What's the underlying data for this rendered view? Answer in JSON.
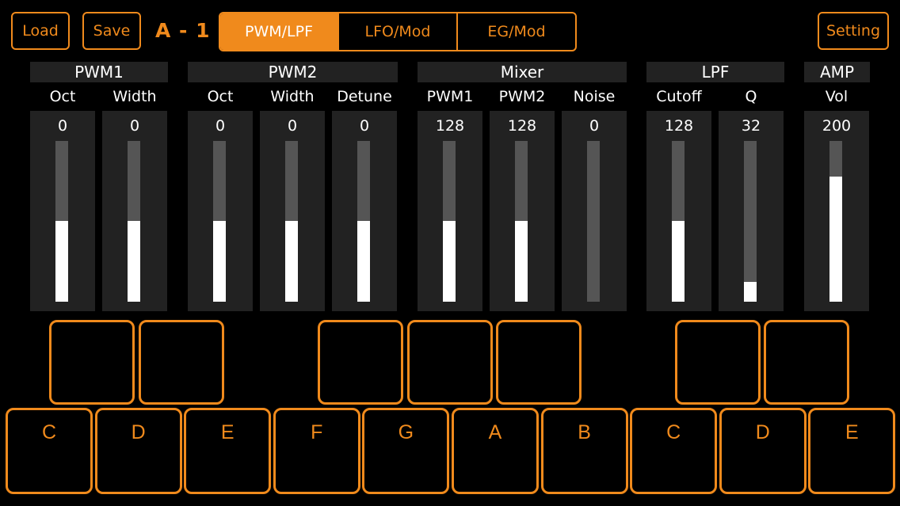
{
  "header": {
    "load_label": "Load",
    "save_label": "Save",
    "preset_name": "A - 1",
    "setting_label": "Setting",
    "accent_color": "#f08a1c",
    "tabs": [
      {
        "label": "PWM/LPF",
        "active": true
      },
      {
        "label": "LFO/Mod",
        "active": false
      },
      {
        "label": "EG/Mod",
        "active": false
      }
    ]
  },
  "groups": [
    "PWM1",
    "PWM2",
    "Mixer",
    "LPF",
    "AMP"
  ],
  "params": [
    {
      "label": "Oct",
      "value": "0",
      "level": 0.5
    },
    {
      "label": "Width",
      "value": "0",
      "level": 0.5
    },
    {
      "label": "Oct",
      "value": "0",
      "level": 0.5
    },
    {
      "label": "Width",
      "value": "0",
      "level": 0.5
    },
    {
      "label": "Detune",
      "value": "0",
      "level": 0.5
    },
    {
      "label": "PWM1",
      "value": "128",
      "level": 0.5
    },
    {
      "label": "PWM2",
      "value": "128",
      "level": 0.5
    },
    {
      "label": "Noise",
      "value": "0",
      "level": 0.0
    },
    {
      "label": "Cutoff",
      "value": "128",
      "level": 0.5
    },
    {
      "label": "Q",
      "value": "32",
      "level": 0.125
    },
    {
      "label": "Vol",
      "value": "200",
      "level": 0.78
    }
  ],
  "keyboard": {
    "white_keys": [
      "C",
      "D",
      "E",
      "F",
      "G",
      "A",
      "B",
      "C",
      "D",
      "E"
    ],
    "black_key_count": 7
  }
}
